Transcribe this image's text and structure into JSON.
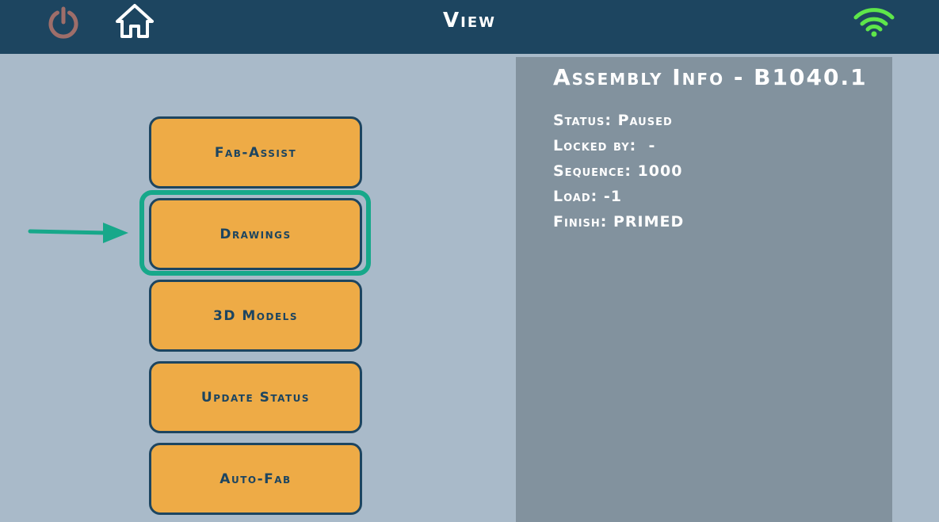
{
  "header": {
    "title": "View",
    "icons": {
      "power": "power-icon",
      "home": "home-icon",
      "wifi": "wifi-icon"
    },
    "colors": {
      "bar": "#1d4560",
      "power": "#9e6e6a",
      "home": "#ffffff",
      "wifi": "#5ee64a"
    }
  },
  "menu": {
    "buttons": [
      {
        "label": "Fab-Assist"
      },
      {
        "label": "Drawings"
      },
      {
        "label": "3D Models"
      },
      {
        "label": "Update Status"
      },
      {
        "label": "Auto-Fab"
      }
    ],
    "highlighted": "Drawings",
    "colors": {
      "button": "#eeab46",
      "highlight": "#17a88a"
    }
  },
  "assembly_info": {
    "title": "Assembly Info - B1040.1",
    "status": "Status: Paused",
    "locked_by": "Locked by:  -",
    "sequence": "Sequence: 1000",
    "load": "Load: -1",
    "finish": "Finish: PRIMED",
    "colors": {
      "panel": "#82929e"
    }
  }
}
